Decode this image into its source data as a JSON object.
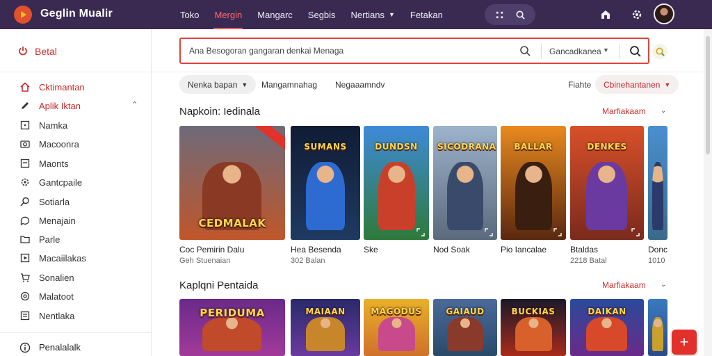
{
  "app": {
    "brand": "Geglin Mualir"
  },
  "nav": [
    {
      "label": "Toko",
      "active": false,
      "caret": false
    },
    {
      "label": "Mergin",
      "active": true,
      "caret": false
    },
    {
      "label": "Mangarc",
      "active": false,
      "caret": false
    },
    {
      "label": "Segbis",
      "active": false,
      "caret": false
    },
    {
      "label": "Nertians",
      "active": false,
      "caret": true
    },
    {
      "label": "Fetakan",
      "active": false,
      "caret": false
    }
  ],
  "sidebar": {
    "header": "Betal",
    "items": [
      {
        "label": "Cktimantan",
        "icon": "home-icon",
        "red": true
      },
      {
        "label": "Aplik Iktan",
        "icon": "pen-icon",
        "red": true,
        "caret": true
      },
      {
        "label": "Namka",
        "icon": "square-icon",
        "red": false
      },
      {
        "label": "Macoonra",
        "icon": "camera-icon",
        "red": false
      },
      {
        "label": "Maonts",
        "icon": "box-icon",
        "red": false
      },
      {
        "label": "Gantcpaile",
        "icon": "gear-icon",
        "red": false
      },
      {
        "label": "Sotiarla",
        "icon": "search-icon",
        "red": false
      },
      {
        "label": "Menajain",
        "icon": "chat-icon",
        "red": false
      },
      {
        "label": "Parle",
        "icon": "folder-icon",
        "red": false
      },
      {
        "label": "Macaiilakas",
        "icon": "play-icon",
        "red": false
      },
      {
        "label": "Sonalien",
        "icon": "cart-icon",
        "red": false
      },
      {
        "label": "Malatoot",
        "icon": "settings-icon",
        "red": false
      },
      {
        "label": "Nentlaka",
        "icon": "list-icon",
        "red": false
      }
    ],
    "footer": "Penalalalk"
  },
  "search": {
    "value": "Ana Besogoran gangaran denkai Menaga",
    "category": "Gancadkanea"
  },
  "filters": {
    "chips": [
      "Nenka bapan",
      "Mangamnahag",
      "Negaaamndv"
    ],
    "sort_label": "Fiahte",
    "sort_value": "Cbinehantanen"
  },
  "sections": [
    {
      "title": "Napkoin: Iedinala",
      "more": "Marfiakaam",
      "cards": [
        {
          "name": "Coc Pemirin Dalu",
          "sub": "Geh Stuenaian",
          "art": "CEDMALAK",
          "top": "#6e6a7a",
          "bottom": "#c0562a",
          "hero": "#8a3a24",
          "badge": true
        },
        {
          "name": "Hea Besenda",
          "sub": "302 Balan",
          "art": "SUMANS",
          "top": "#101c34",
          "bottom": "#1f3a62",
          "hero": "#2d6bd0",
          "badge": false
        },
        {
          "name": "Ske",
          "sub": "",
          "art": "DUNDSN",
          "top": "#3f8ad8",
          "bottom": "#2e7a3a",
          "hero": "#c8402a",
          "badge": false
        },
        {
          "name": "Nod Soak",
          "sub": "",
          "art": "SICODRANA",
          "top": "#9db3cc",
          "bottom": "#5b6a7c",
          "hero": "#3a4a6a",
          "badge": false
        },
        {
          "name": "Pio Iancalae",
          "sub": "",
          "art": "BALLAR",
          "top": "#e8891e",
          "bottom": "#5a2810",
          "hero": "#3a1e10",
          "badge": false
        },
        {
          "name": "Btaldas",
          "sub": "2218 Batal",
          "art": "DENKES",
          "top": "#d8502a",
          "bottom": "#7a2a1c",
          "hero": "#6a3aa0",
          "badge": false
        },
        {
          "name": "Donc",
          "sub": "1010",
          "art": "",
          "top": "#4a8fd0",
          "bottom": "#3a6a8a",
          "hero": "#2a3a6a",
          "badge": false
        }
      ]
    },
    {
      "title": "Kaplqni Pentaida",
      "more": "Marfiakaam",
      "cards": [
        {
          "name": "",
          "sub": "",
          "art": "PERIDUMA",
          "top": "#6a2a8a",
          "bottom": "#a23a9a",
          "hero": "#c04a2a"
        },
        {
          "name": "",
          "sub": "",
          "art": "MAIAAN",
          "top": "#2a2a6a",
          "bottom": "#6a3aa0",
          "hero": "#c8862a"
        },
        {
          "name": "",
          "sub": "",
          "art": "MAGODUS",
          "top": "#e8b02a",
          "bottom": "#d0702a",
          "hero": "#c84a8a"
        },
        {
          "name": "",
          "sub": "",
          "art": "GAIAUD",
          "top": "#4a6a9a",
          "bottom": "#2a4a6a",
          "hero": "#8a3a2a"
        },
        {
          "name": "",
          "sub": "",
          "art": "BUCKIAS",
          "top": "#1a1a2a",
          "bottom": "#a82a1a",
          "hero": "#d8602a"
        },
        {
          "name": "",
          "sub": "",
          "art": "DAIKAN",
          "top": "#2a4a9a",
          "bottom": "#6a2a8a",
          "hero": "#d8482a"
        },
        {
          "name": "",
          "sub": "",
          "art": "",
          "top": "#3a7ac0",
          "bottom": "#2a4a8a",
          "hero": "#c8a02a"
        }
      ]
    }
  ]
}
